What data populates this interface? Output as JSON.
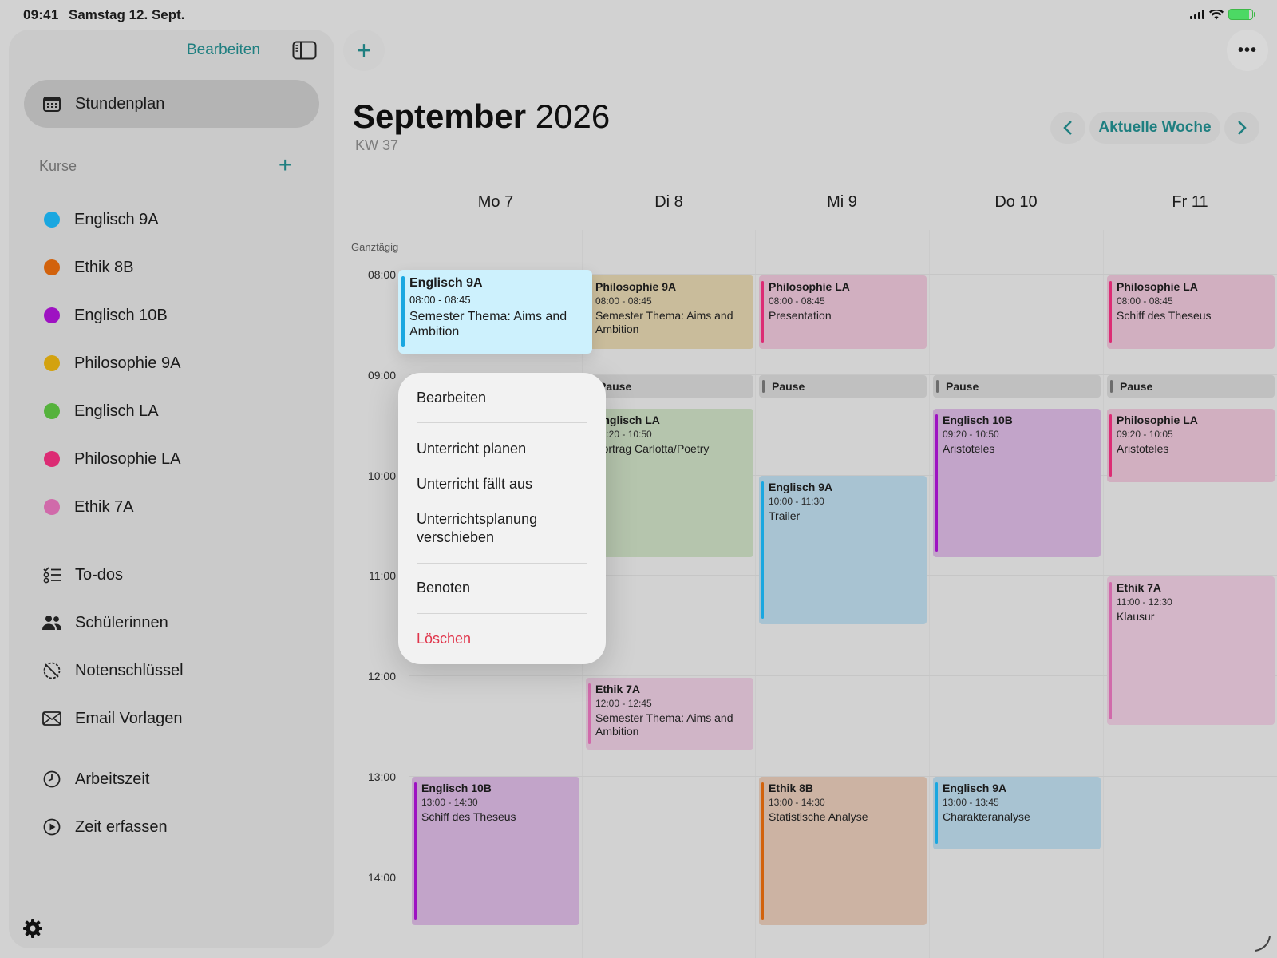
{
  "status_bar": {
    "time": "09:41",
    "date": "Samstag 12. Sept."
  },
  "sidebar": {
    "edit_label": "Bearbeiten",
    "active_item": "Stundenplan",
    "courses_header": "Kurse",
    "courses": [
      {
        "label": "Englisch 9A",
        "color": "#1aa7e0"
      },
      {
        "label": "Ethik 8B",
        "color": "#d2620c"
      },
      {
        "label": "Englisch 10B",
        "color": "#9e12c2"
      },
      {
        "label": "Philosophie 9A",
        "color": "#d3a20f"
      },
      {
        "label": "Englisch LA",
        "color": "#55b23c"
      },
      {
        "label": "Philosophie LA",
        "color": "#dc2c74"
      },
      {
        "label": "Ethik 7A",
        "color": "#d06aaa"
      }
    ],
    "tools": [
      {
        "label": "To-dos",
        "icon": "checklist-icon"
      },
      {
        "label": "Schülerinnen",
        "icon": "people-icon"
      },
      {
        "label": "Notenschlüssel",
        "icon": "grade-key-icon"
      },
      {
        "label": "Email Vorlagen",
        "icon": "envelope-icon"
      }
    ],
    "time_items": [
      {
        "label": "Arbeitszeit",
        "icon": "clock-icon"
      },
      {
        "label": "Zeit erfassen",
        "icon": "play-circle-icon"
      }
    ]
  },
  "header": {
    "month": "September",
    "year": "2026",
    "week": "KW 37",
    "current_week_label": "Aktuelle Woche"
  },
  "calendar": {
    "days": [
      "Mo 7",
      "Di 8",
      "Mi 9",
      "Do 10",
      "Fr 11"
    ],
    "all_day_label": "Ganztägig",
    "hours": [
      "08:00",
      "09:00",
      "10:00",
      "11:00",
      "12:00",
      "13:00",
      "14:00"
    ],
    "pause_label": "Pause",
    "events": {
      "mo_1": {
        "title": "Englisch 9A",
        "time": "08:00 - 08:45",
        "desc": "Semester Thema: Aims and Ambition"
      },
      "mo_2": {
        "title": "Englisch 10B",
        "time": "13:00 - 14:30",
        "desc": "Schiff des Theseus"
      },
      "di_1": {
        "title": "Philosophie 9A",
        "time": "08:00 - 08:45",
        "desc": "Semester Thema: Aims and Ambition"
      },
      "di_2": {
        "title": "Englisch LA",
        "time": "09:20 - 10:50",
        "desc": "Vortrag Carlotta/Poetry"
      },
      "di_3": {
        "title": "Ethik 7A",
        "time": "12:00 - 12:45",
        "desc": "Semester Thema: Aims and Ambition"
      },
      "mi_1": {
        "title": "Philosophie LA",
        "time": "08:00 - 08:45",
        "desc": "Presentation"
      },
      "mi_2": {
        "title": "Englisch 9A",
        "time": "10:00 - 11:30",
        "desc": "Trailer"
      },
      "mi_3": {
        "title": "Ethik 8B",
        "time": "13:00 - 14:30",
        "desc": "Statistische Analyse"
      },
      "do_1": {
        "title": "Englisch 10B",
        "time": "09:20 - 10:50",
        "desc": "Aristoteles"
      },
      "do_2": {
        "title": "Englisch 9A",
        "time": "13:00 - 13:45",
        "desc": "Charakteranalyse"
      },
      "fr_1": {
        "title": "Philosophie LA",
        "time": "08:00 - 08:45",
        "desc": "Schiff des Theseus"
      },
      "fr_2": {
        "title": "Philosophie LA",
        "time": "09:20 - 10:05",
        "desc": "Aristoteles"
      },
      "fr_3": {
        "title": "Ethik 7A",
        "time": "11:00 - 12:30",
        "desc": "Klausur"
      }
    }
  },
  "context_menu": {
    "edit": "Bearbeiten",
    "plan": "Unterricht planen",
    "cancel": "Unterricht fällt aus",
    "postpone": "Unterrichtsplanung verschieben",
    "grade": "Benoten",
    "delete": "Löschen"
  }
}
